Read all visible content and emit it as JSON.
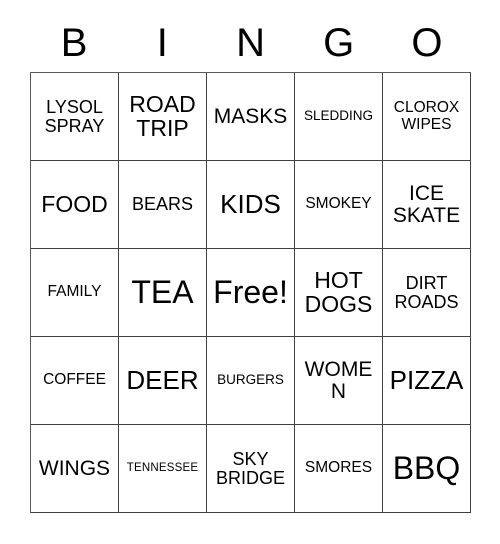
{
  "card": {
    "title": "BINGO",
    "header": {
      "letters": [
        "B",
        "I",
        "N",
        "G",
        "O"
      ]
    },
    "columns": 5,
    "rows": 5,
    "free_space_label": "Free!",
    "free_space_position": {
      "row": 3,
      "col": 3
    },
    "colors": {
      "background": "#ffffff",
      "cell_background": "#ffffff",
      "grid_line": "#404040",
      "text": "#000000"
    },
    "cells": [
      [
        {
          "text": "LYSOL\nSPRAY",
          "size": "lg"
        },
        {
          "text": "ROAD\nTRIP",
          "size": "2xl"
        },
        {
          "text": "MASKS",
          "size": "xl"
        },
        {
          "text": "SLEDDING",
          "size": "sm"
        },
        {
          "text": "CLOROX\nWIPES",
          "size": "md"
        }
      ],
      [
        {
          "text": "FOOD",
          "size": "2xl"
        },
        {
          "text": "BEARS",
          "size": "lg"
        },
        {
          "text": "KIDS",
          "size": "3xl"
        },
        {
          "text": "SMOKEY",
          "size": "md"
        },
        {
          "text": "ICE\nSKATE",
          "size": "xl"
        }
      ],
      [
        {
          "text": "FAMILY",
          "size": "md"
        },
        {
          "text": "TEA",
          "size": "4xl"
        },
        {
          "text": "Free!",
          "size": "4xl"
        },
        {
          "text": "HOT\nDOGS",
          "size": "2xl"
        },
        {
          "text": "DIRT\nROADS",
          "size": "lg"
        }
      ],
      [
        {
          "text": "COFFEE",
          "size": "md"
        },
        {
          "text": "DEER",
          "size": "3xl"
        },
        {
          "text": "BURGERS",
          "size": "sm"
        },
        {
          "text": "WOMEN",
          "size": "xl"
        },
        {
          "text": "PIZZA",
          "size": "3xl"
        }
      ],
      [
        {
          "text": "WINGS",
          "size": "xl"
        },
        {
          "text": "TENNESSEE",
          "size": "xs"
        },
        {
          "text": "SKY\nBRIDGE",
          "size": "lg"
        },
        {
          "text": "SMORES",
          "size": "md"
        },
        {
          "text": "BBQ",
          "size": "4xl"
        }
      ]
    ]
  }
}
